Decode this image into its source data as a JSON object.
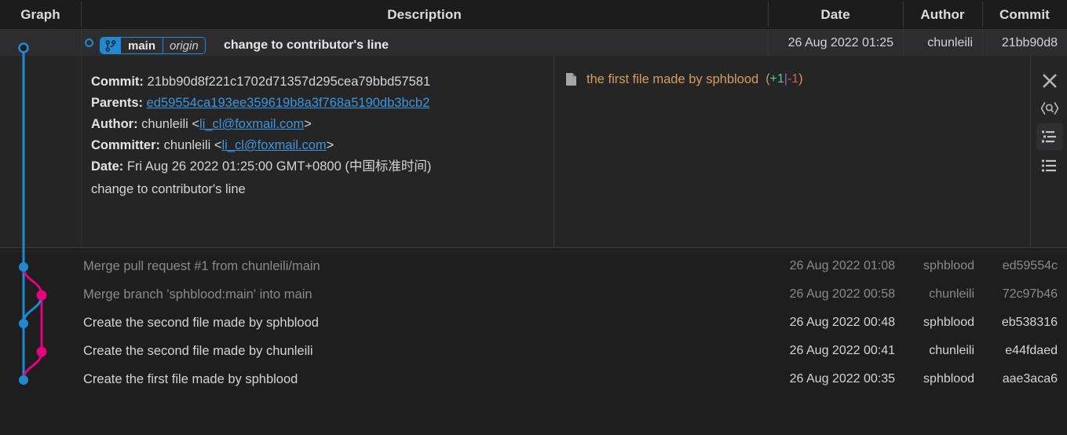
{
  "colors": {
    "background": "#1e1e1e",
    "header_background": "#1c1c1c",
    "panel_background": "#252526",
    "selected_row_background": "#2d2d30",
    "accent_blue": "#1f8ad2",
    "graph_blue": "#1f8ad2",
    "graph_pink": "#e4007f",
    "link_blue": "#3d96dd",
    "file_orange": "#d89b5c",
    "additions_green": "#4ec994",
    "deletions_red": "#d9595b",
    "text_primary": "#d4d4d4",
    "text_dim": "#8a8a8a",
    "divider": "#3a3a3d"
  },
  "header": {
    "columns": [
      {
        "label": "Graph",
        "name": "column-header-graph"
      },
      {
        "label": "Description",
        "name": "column-header-description"
      },
      {
        "label": "Date",
        "name": "column-header-date"
      },
      {
        "label": "Author",
        "name": "column-header-author"
      },
      {
        "label": "Commit",
        "name": "column-header-commit"
      }
    ]
  },
  "selected_commit": {
    "branch_badge": {
      "name": "main",
      "remote": "origin",
      "icon": "git-branch-icon"
    },
    "subject": "change to contributor's line",
    "date": "26 Aug 2022 01:25",
    "author": "chunleili",
    "hash_short": "21bb90d8"
  },
  "detail": {
    "labels": {
      "commit": "Commit:",
      "parents": "Parents:",
      "author": "Author:",
      "committer": "Committer:",
      "date": "Date:"
    },
    "commit_full": "21bb90d8f221c1702d71357d295cea79bbd57581",
    "parents": "ed59554ca193ee359619b8a3f768a5190db3bcb2",
    "author_name": "chunleili",
    "author_email": "li_cl@foxmail.com",
    "committer_name": "chunleili",
    "committer_email": "li_cl@foxmail.com",
    "date_full": "Fri Aug 26 2022 01:25:00 GMT+0800 (中国标准时间)",
    "body": "change to contributor's line",
    "email_open": "<",
    "email_close": ">",
    "files": [
      {
        "icon": "file-icon",
        "name": "the first file made by sphblood",
        "paren_open": "(",
        "additions": "+1",
        "separator": "|",
        "deletions": "-1",
        "paren_close": ")"
      }
    ],
    "toolbar": [
      {
        "name": "close-icon",
        "label": "Close",
        "active": false
      },
      {
        "name": "code-review-icon",
        "label": "Code Review",
        "active": false
      },
      {
        "name": "file-tree-view-icon",
        "label": "File Tree View",
        "active": true
      },
      {
        "name": "file-list-view-icon",
        "label": "File List View",
        "active": false
      }
    ]
  },
  "commits": [
    {
      "subject": "Merge pull request #1 from chunleili/main",
      "date": "26 Aug 2022 01:08",
      "author": "sphblood",
      "hash": "ed59554c",
      "dim": true
    },
    {
      "subject": "Merge branch 'sphblood:main' into main",
      "date": "26 Aug 2022 00:58",
      "author": "chunleili",
      "hash": "72c97b46",
      "dim": true
    },
    {
      "subject": "Create the second file made by sphblood",
      "date": "26 Aug 2022 00:48",
      "author": "sphblood",
      "hash": "eb538316",
      "dim": false
    },
    {
      "subject": "Create the second file made by chunleili",
      "date": "26 Aug 2022 00:41",
      "author": "chunleili",
      "hash": "e44fdaed",
      "dim": false
    },
    {
      "subject": "Create the first file made by sphblood",
      "date": "26 Aug 2022 00:35",
      "author": "sphblood",
      "hash": "aae3aca6",
      "dim": false
    }
  ]
}
